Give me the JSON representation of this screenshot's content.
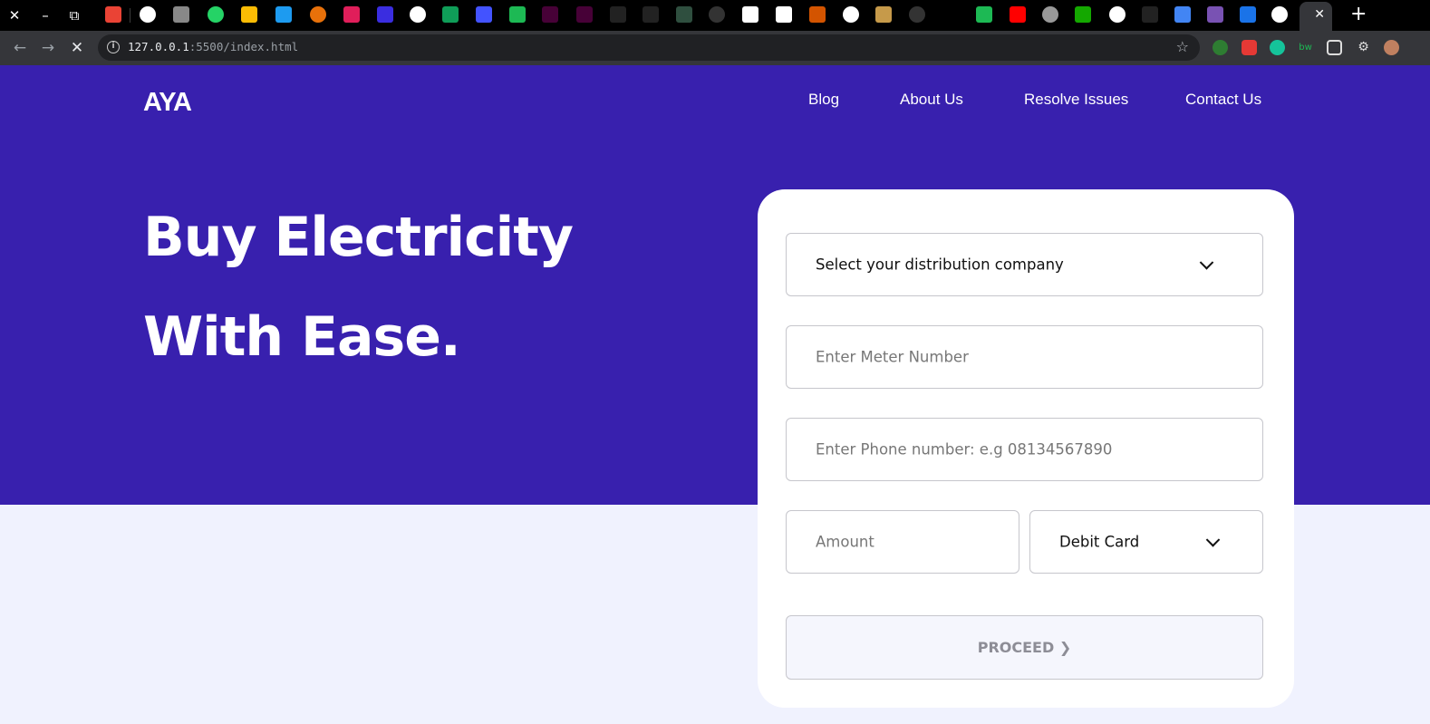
{
  "browser": {
    "url_host": "127.0.0.1",
    "url_path": ":5500/index.html",
    "window_close": "✕",
    "window_min": "–",
    "window_restore": "⧉",
    "new_tab": "+",
    "active_tab_close": "✕",
    "tab_icons": [
      "gmail-icon",
      "github-icon",
      "ethereum-icon",
      "whatsapp-icon",
      "google-drive-icon",
      "twitter-icon",
      "eye-icon",
      "slack-icon",
      "info-icon",
      "globe-icon",
      "google-sheets-icon",
      "deploy-icon",
      "webflow-icon",
      "xd-icon",
      "xd-icon",
      "code-icon",
      "code-icon",
      "terminal-icon",
      "github-icon",
      "c-icon",
      "chart-icon",
      "l-icon",
      "target-icon",
      "mascot-icon",
      "github-icon",
      "blank-icon",
      "webflow-icon",
      "youtube-icon",
      "globe-icon",
      "upwork-icon",
      "google-icon",
      "slash-icon",
      "docs-icon",
      "bootstrap-icon",
      "flag-icon",
      "google-icon"
    ]
  },
  "site": {
    "logo": "AYA",
    "nav": {
      "blog": "Blog",
      "about": "About Us",
      "resolve": "Resolve Issues",
      "contact": "Contact Us"
    },
    "headline_line1": "Buy Electricity",
    "headline_line2": "With Ease.",
    "colors": {
      "hero_bg": "#3820ae",
      "page_bg": "#f0f2fe"
    }
  },
  "form": {
    "distribution_select": "Select your distribution company",
    "meter_placeholder": "Enter Meter Number",
    "phone_placeholder": "Enter Phone number: e.g 08134567890",
    "amount_placeholder": "Amount",
    "payment_method": "Debit Card",
    "proceed_label": "PROCEED",
    "proceed_chevron": "❯"
  }
}
